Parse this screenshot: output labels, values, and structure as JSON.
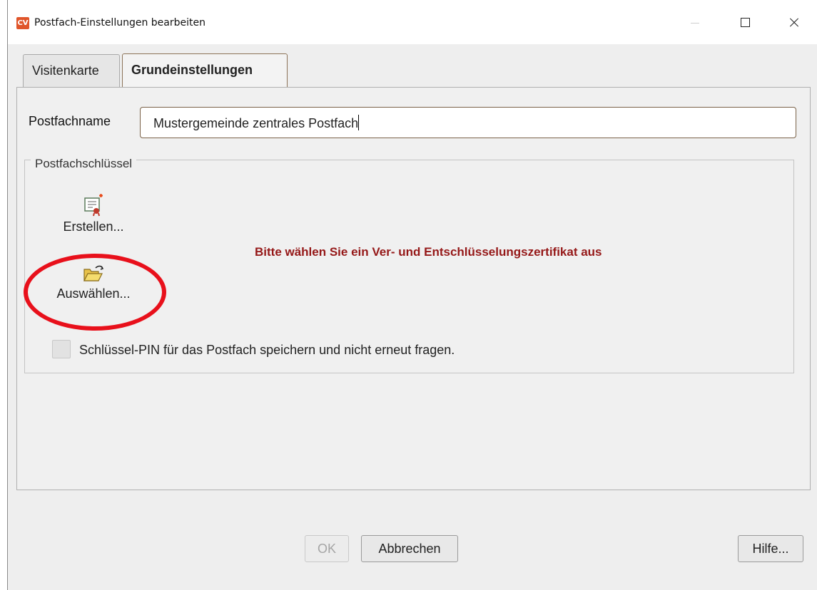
{
  "window": {
    "title": "Postfach-Einstellungen bearbeiten",
    "app_icon_text": "CV"
  },
  "tabs": [
    {
      "label": "Visitenkarte",
      "active": false
    },
    {
      "label": "Grundeinstellungen",
      "active": true
    }
  ],
  "form": {
    "postfachname_label": "Postfachname",
    "postfachname_value": "Mustergemeinde zentrales Postfach"
  },
  "key_group": {
    "legend": "Postfachschlüssel",
    "create_label": "Erstellen...",
    "create_icon": "certificate-new-icon",
    "select_label": "Auswählen...",
    "select_icon": "open-folder-icon",
    "warning_text": "Bitte wählen Sie ein Ver- und Entschlüsselungszertifikat aus",
    "warning_color": "#951818",
    "save_pin_label": "Schlüssel-PIN für das Postfach speichern und nicht erneut fragen.",
    "save_pin_checked": false
  },
  "annotation": {
    "highlight_color": "#e8101b"
  },
  "buttons": {
    "ok": "OK",
    "ok_enabled": false,
    "cancel": "Abbrechen",
    "help": "Hilfe..."
  }
}
